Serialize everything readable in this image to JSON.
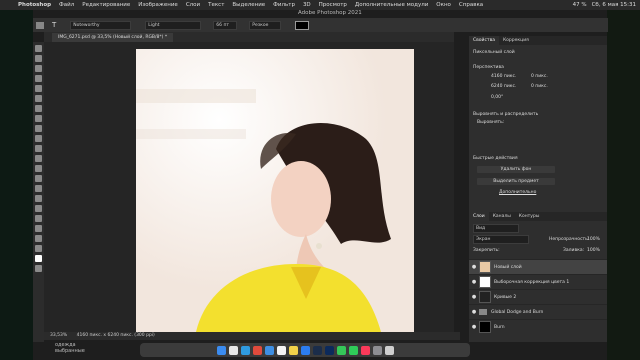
{
  "menubar": {
    "app": "Photoshop",
    "items": [
      "Файл",
      "Редактирование",
      "Изображение",
      "Слои",
      "Текст",
      "Выделение",
      "Фильтр",
      "3D",
      "Просмотр",
      "Дополнительные модули",
      "Окно",
      "Справка"
    ],
    "battery": "47 %",
    "datetime": "Сб, 6 мая 15:31"
  },
  "app_title": "Adobe Photoshop 2021",
  "options": {
    "font": "Noteworthy",
    "style": "Light",
    "size": "66 пт",
    "aa": "Резкое"
  },
  "document_tab": "IMG_6271.psd @ 33,5% (Новый слой, RGB/8*) *",
  "status": {
    "zoom": "33,53%",
    "info": "4160 пикс. x 6240 пикс. (300 ppi)"
  },
  "properties": {
    "tab1": "Свойства",
    "tab2": "Коррекция",
    "layer_type": "Пиксельный слой",
    "transform_title": "Перспектива",
    "w": "4160 пикс.",
    "h": "6240 пикс.",
    "x": "0 пикс.",
    "y": "0 пикс.",
    "angle": "0,00°",
    "align_title": "Выровнять и распределить",
    "align_label": "Выровнять:",
    "quick_title": "Быстрые действия",
    "btn_remove_bg": "Удалить фон",
    "btn_select_subject": "Выделить предмет",
    "more": "Дополнительно"
  },
  "layers": {
    "tabs": [
      "Слои",
      "Каналы",
      "Контуры"
    ],
    "filter": "Вид",
    "blend": "Экран",
    "opacity_label": "Непрозрачность:",
    "opacity": "100%",
    "lock_label": "Закрепить:",
    "fill_label": "Заливка:",
    "fill": "100%",
    "rows": [
      "Новый слой",
      "Выборочная коррекция цвета 1",
      "Кривые 2",
      "Global Dodge and Burn",
      "Burn"
    ]
  },
  "bottom_left": {
    "line1": "одежда",
    "line2": "выбранные"
  }
}
